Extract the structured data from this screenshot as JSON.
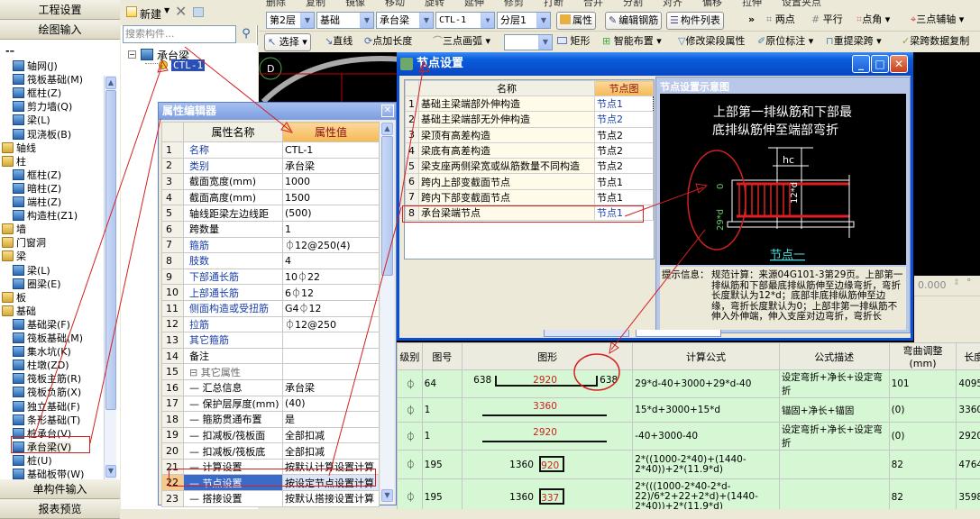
{
  "left_nav": {
    "top_buttons": [
      "工程设置",
      "绘图输入"
    ],
    "bottom_buttons": [
      "单构件输入",
      "报表预览"
    ],
    "tree": [
      {
        "label": "轴网(J)",
        "level": 1,
        "icon": "grid-icon"
      },
      {
        "label": "筏板基础(M)",
        "level": 1,
        "icon": "raft-icon"
      },
      {
        "label": "框柱(Z)",
        "level": 1,
        "icon": "column-icon"
      },
      {
        "label": "剪力墙(Q)",
        "level": 1,
        "icon": "wall-icon"
      },
      {
        "label": "梁(L)",
        "level": 1,
        "icon": "beam-icon"
      },
      {
        "label": "现浇板(B)",
        "level": 1,
        "icon": "slab-icon"
      },
      {
        "label": "轴线",
        "level": 0,
        "icon": "folder-icon"
      },
      {
        "label": "柱",
        "level": 0,
        "icon": "folder-open-icon"
      },
      {
        "label": "框柱(Z)",
        "level": 1,
        "icon": "column-icon"
      },
      {
        "label": "暗柱(Z)",
        "level": 1,
        "icon": "column-icon"
      },
      {
        "label": "端柱(Z)",
        "level": 1,
        "icon": "column-icon"
      },
      {
        "label": "构造柱(Z1)",
        "level": 1,
        "icon": "construct-column-icon"
      },
      {
        "label": "墙",
        "level": 0,
        "icon": "folder-icon"
      },
      {
        "label": "门窗洞",
        "level": 0,
        "icon": "folder-icon"
      },
      {
        "label": "梁",
        "level": 0,
        "icon": "folder-open-icon"
      },
      {
        "label": "梁(L)",
        "level": 1,
        "icon": "beam-icon"
      },
      {
        "label": "圈梁(E)",
        "level": 1,
        "icon": "ring-beam-icon"
      },
      {
        "label": "板",
        "level": 0,
        "icon": "folder-icon"
      },
      {
        "label": "基础",
        "level": 0,
        "icon": "folder-open-icon"
      },
      {
        "label": "基础梁(F)",
        "level": 1,
        "icon": "foundation-beam-icon"
      },
      {
        "label": "筏板基础(M)",
        "level": 1,
        "icon": "raft-icon"
      },
      {
        "label": "集水坑(K)",
        "level": 1,
        "icon": "sump-icon"
      },
      {
        "label": "柱墩(ZD)",
        "level": 1,
        "icon": "pier-icon"
      },
      {
        "label": "筏板主筋(R)",
        "level": 1,
        "icon": "raft-rebar-icon"
      },
      {
        "label": "筏板负筋(X)",
        "level": 1,
        "icon": "raft-neg-rebar-icon"
      },
      {
        "label": "独立基础(F)",
        "level": 1,
        "icon": "isolated-footing-icon"
      },
      {
        "label": "条形基础(T)",
        "level": 1,
        "icon": "strip-footing-icon"
      },
      {
        "label": "桩承台(V)",
        "level": 1,
        "icon": "pile-cap-icon"
      },
      {
        "label": "承台梁(V)",
        "level": 1,
        "icon": "cap-beam-icon",
        "selected": true
      },
      {
        "label": "桩(U)",
        "level": 1,
        "icon": "pile-icon"
      },
      {
        "label": "基础板带(W)",
        "level": 1,
        "icon": "foundation-strip-icon"
      }
    ]
  },
  "component_panel": {
    "new_label": "新建",
    "search_placeholder": "搜索构件...",
    "tree_root": "承台梁",
    "tree_child": "CTL-1"
  },
  "toolbar0": {
    "items": [
      "删除",
      "复制",
      "镜像",
      "移动",
      "旋转",
      "延伸",
      "修剪",
      "打断",
      "合并",
      "分割",
      "对齐",
      "偏移",
      "拉伸",
      "设置夹点"
    ]
  },
  "toolbar1": {
    "floor": "第2层",
    "category": "基础",
    "type": "承台梁",
    "component": "CTL-1",
    "layer": "分层1",
    "properties_btn": "属性",
    "edit_rebar_btn": "编辑钢筋",
    "component_list_btn": "构件列表",
    "more": "»",
    "two_points": "两点",
    "parallel": "平行",
    "point_angle": "点角",
    "three_point_axis": "三点辅轴"
  },
  "toolbar2": {
    "select": "选择",
    "line": "直线",
    "point_length": "点加长度",
    "three_point_arc": "三点画弧",
    "rectangle": "矩形",
    "smart_layout": "智能布置",
    "modify_span": "修改梁段属性",
    "in_situ_mark": "原位标注",
    "re_extract_span": "重提梁跨",
    "copy_span_data": "梁跨数据复制"
  },
  "property_editor": {
    "title": "属性编辑器",
    "col_name": "属性名称",
    "col_value": "属性值",
    "rows": [
      {
        "n": "1",
        "name": "名称",
        "value": "CTL-1",
        "style": "blue"
      },
      {
        "n": "2",
        "name": "类别",
        "value": "承台梁",
        "style": "blue"
      },
      {
        "n": "3",
        "name": "截面宽度(mm)",
        "value": "1000",
        "style": ""
      },
      {
        "n": "4",
        "name": "截面高度(mm)",
        "value": "1500",
        "style": ""
      },
      {
        "n": "5",
        "name": "轴线距梁左边线距",
        "value": "(500)",
        "style": ""
      },
      {
        "n": "6",
        "name": "跨数量",
        "value": "1",
        "style": ""
      },
      {
        "n": "7",
        "name": "箍筋",
        "value": "⏀12@250(4)",
        "style": "blue"
      },
      {
        "n": "8",
        "name": "肢数",
        "value": "4",
        "style": "blue"
      },
      {
        "n": "9",
        "name": "下部通长筋",
        "value": "10⏀22",
        "style": "blue"
      },
      {
        "n": "10",
        "name": "上部通长筋",
        "value": "6⏀12",
        "style": "blue"
      },
      {
        "n": "11",
        "name": "侧面构造或受扭筋",
        "value": "G4⏀12",
        "style": "blue"
      },
      {
        "n": "12",
        "name": "拉筋",
        "value": "⏀12@250",
        "style": "blue"
      },
      {
        "n": "13",
        "name": "其它箍筋",
        "value": "",
        "style": "blue"
      },
      {
        "n": "14",
        "name": "备注",
        "value": "",
        "style": ""
      },
      {
        "n": "15",
        "name": "⊟ 其它属性",
        "value": "",
        "style": "grey"
      },
      {
        "n": "16",
        "name": "— 汇总信息",
        "value": "承台梁",
        "style": ""
      },
      {
        "n": "17",
        "name": "— 保护层厚度(mm)",
        "value": "(40)",
        "style": ""
      },
      {
        "n": "18",
        "name": "— 箍筋贯通布置",
        "value": "是",
        "style": ""
      },
      {
        "n": "19",
        "name": "— 扣减板/筏板面",
        "value": "全部扣减",
        "style": ""
      },
      {
        "n": "20",
        "name": "— 扣减板/筏板底",
        "value": "全部扣减",
        "style": ""
      },
      {
        "n": "21",
        "name": "— 计算设置",
        "value": "按默认计算设置计算",
        "style": ""
      },
      {
        "n": "22",
        "name": "— 节点设置",
        "value": "按设定节点设置计算",
        "style": "",
        "selected": true
      },
      {
        "n": "23",
        "name": "— 搭接设置",
        "value": "按默认搭接设置计算",
        "style": ""
      }
    ]
  },
  "node_dialog": {
    "title": "节点设置",
    "col_name": "名称",
    "col_value": "节点图",
    "rows": [
      {
        "n": "1",
        "name": "基础主梁端部外伸构造",
        "value": "节点1",
        "blue": true
      },
      {
        "n": "2",
        "name": "基础主梁端部无外伸构造",
        "value": "节点2",
        "blue": true
      },
      {
        "n": "3",
        "name": "梁顶有高差构造",
        "value": "节点2",
        "blue": false
      },
      {
        "n": "4",
        "name": "梁底有高差构造",
        "value": "节点2",
        "blue": false
      },
      {
        "n": "5",
        "name": "梁支座两侧梁宽或纵筋数量不同构造",
        "value": "节点2",
        "blue": false
      },
      {
        "n": "6",
        "name": "跨内上部变截面节点",
        "value": "节点1",
        "blue": false
      },
      {
        "n": "7",
        "name": "跨内下部变截面节点",
        "value": "节点1",
        "blue": false
      },
      {
        "n": "8",
        "name": "承台梁端节点",
        "value": "节点1",
        "blue": true
      }
    ],
    "diagram_title": "节点设置示意图",
    "diagram_caption_line1": "上部第一排纵筋和下部最",
    "diagram_caption_line2": "底排纵筋伸至端部弯折",
    "diagram_hc": "hc",
    "diagram_12d": "12*d",
    "diagram_29d": "29*d",
    "diagram_0": "0",
    "diagram_node_label": "节点一",
    "hint_label": "提示信息：",
    "hint_text": "规范计算：来源04G101-3第29页。上部第一排纵筋和下部最底排纵筋伸至边缘弯折，弯折长度默认为12*d；底部非底排纵筋伸至边缘，弯折长度默认为0；上部非第一排纵筋不伸入外伸端，伸入支座对边弯折，弯折长"
  },
  "status": {
    "angle_value": "0.000"
  },
  "rebar_table": {
    "headers": [
      "级别",
      "图号",
      "图形",
      "计算公式",
      "公式描述",
      "弯曲调整(mm)",
      "长度"
    ],
    "rows": [
      {
        "grade": "⏀",
        "fig": "64",
        "left": "638",
        "mid": "2920",
        "right": "638",
        "shape": "u",
        "formula": "29*d-40+3000+29*d-40",
        "desc": "设定弯折+净长+设定弯折",
        "bend": "101",
        "length": "4095"
      },
      {
        "grade": "⏀",
        "fig": "1",
        "mid": "3360",
        "shape": "line",
        "formula": "15*d+3000+15*d",
        "desc": "锚固+净长+锚固",
        "bend": "(0)",
        "length": "3360"
      },
      {
        "grade": "⏀",
        "fig": "1",
        "mid": "2920",
        "shape": "line",
        "formula": "-40+3000-40",
        "desc": "设定弯折+净长+设定弯折",
        "bend": "(0)",
        "length": "2920"
      },
      {
        "grade": "⏀",
        "fig": "195",
        "left": "1360",
        "mid": "920",
        "shape": "box",
        "formula": "2*((1000-2*40)+(1440-2*40))+2*(11.9*d)",
        "desc": "",
        "bend": "82",
        "length": "4764"
      },
      {
        "grade": "⏀",
        "fig": "195",
        "left": "1360",
        "mid": "337",
        "shape": "box",
        "formula": "2*(((1000-2*40-2*d-22)/6*2+22+2*d)+(1440-2*40))+2*(11.9*d)",
        "desc": "",
        "bend": "82",
        "length": "3598"
      }
    ]
  },
  "colors": {
    "annotation": "#d42020",
    "xp_blue": "#0a5ddc",
    "rebar_row": "#d6f7d4",
    "header_orange": "#f5b955"
  }
}
